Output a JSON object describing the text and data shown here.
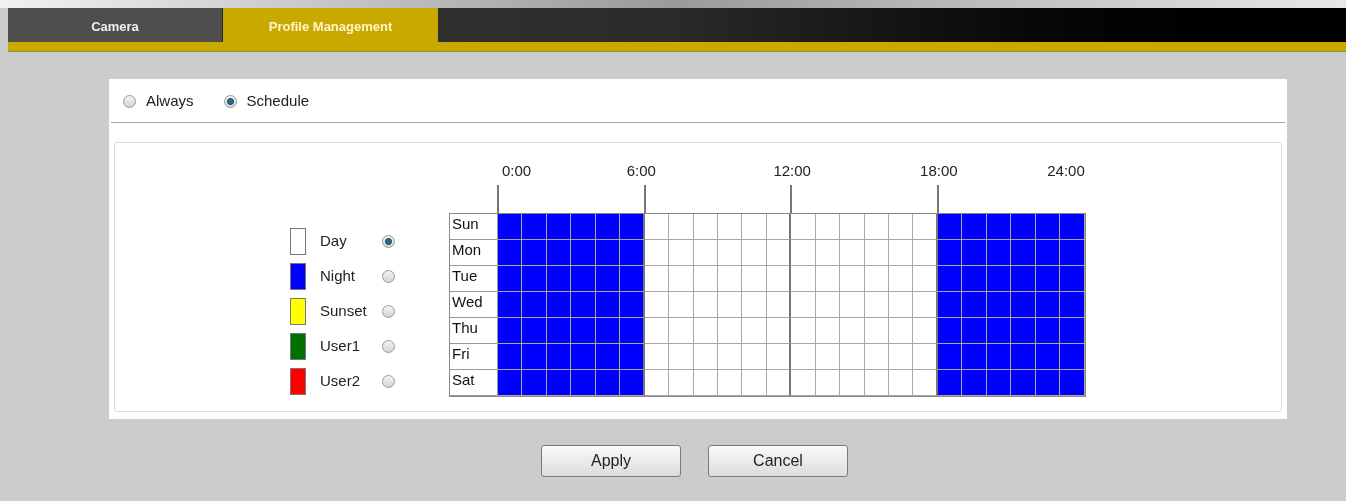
{
  "tabs": [
    {
      "label": "Camera",
      "selected": false
    },
    {
      "label": "Profile Management",
      "selected": true
    }
  ],
  "mode_options": [
    {
      "label": "Always",
      "selected": false
    },
    {
      "label": "Schedule",
      "selected": true
    }
  ],
  "profiles": [
    {
      "label": "Day",
      "color": "#ffffff",
      "selected": true
    },
    {
      "label": "Night",
      "color": "#0000ff",
      "selected": false
    },
    {
      "label": "Sunset",
      "color": "#ffff00",
      "selected": false
    },
    {
      "label": "User1",
      "color": "#007000",
      "selected": false
    },
    {
      "label": "User2",
      "color": "#ff0000",
      "selected": false
    }
  ],
  "time_labels": [
    "0:00",
    "6:00",
    "12:00",
    "18:00",
    "24:00"
  ],
  "schedule": [
    {
      "day": "Sun",
      "cells": [
        {
          "color": "#0000ff"
        },
        {
          "color": "#0000ff"
        },
        {
          "color": "#0000ff"
        },
        {
          "color": "#0000ff"
        },
        {
          "color": "#0000ff"
        },
        {
          "color": "#0000ff"
        },
        {
          "color": "#ffffff"
        },
        {
          "color": "#ffffff"
        },
        {
          "color": "#ffffff"
        },
        {
          "color": "#ffffff"
        },
        {
          "color": "#ffffff"
        },
        {
          "color": "#ffffff"
        },
        {
          "color": "#ffffff"
        },
        {
          "color": "#ffffff"
        },
        {
          "color": "#ffffff"
        },
        {
          "color": "#ffffff"
        },
        {
          "color": "#ffffff"
        },
        {
          "color": "#ffffff"
        },
        {
          "color": "#0000ff"
        },
        {
          "color": "#0000ff"
        },
        {
          "color": "#0000ff"
        },
        {
          "color": "#0000ff"
        },
        {
          "color": "#0000ff"
        },
        {
          "color": "#0000ff"
        }
      ]
    },
    {
      "day": "Mon",
      "cells": [
        {
          "color": "#0000ff"
        },
        {
          "color": "#0000ff"
        },
        {
          "color": "#0000ff"
        },
        {
          "color": "#0000ff"
        },
        {
          "color": "#0000ff"
        },
        {
          "color": "#0000ff"
        },
        {
          "color": "#ffffff"
        },
        {
          "color": "#ffffff"
        },
        {
          "color": "#ffffff"
        },
        {
          "color": "#ffffff"
        },
        {
          "color": "#ffffff"
        },
        {
          "color": "#ffffff"
        },
        {
          "color": "#ffffff"
        },
        {
          "color": "#ffffff"
        },
        {
          "color": "#ffffff"
        },
        {
          "color": "#ffffff"
        },
        {
          "color": "#ffffff"
        },
        {
          "color": "#ffffff"
        },
        {
          "color": "#0000ff"
        },
        {
          "color": "#0000ff"
        },
        {
          "color": "#0000ff"
        },
        {
          "color": "#0000ff"
        },
        {
          "color": "#0000ff"
        },
        {
          "color": "#0000ff"
        }
      ]
    },
    {
      "day": "Tue",
      "cells": [
        {
          "color": "#0000ff"
        },
        {
          "color": "#0000ff"
        },
        {
          "color": "#0000ff"
        },
        {
          "color": "#0000ff"
        },
        {
          "color": "#0000ff"
        },
        {
          "color": "#0000ff"
        },
        {
          "color": "#ffffff"
        },
        {
          "color": "#ffffff"
        },
        {
          "color": "#ffffff"
        },
        {
          "color": "#ffffff"
        },
        {
          "color": "#ffffff"
        },
        {
          "color": "#ffffff"
        },
        {
          "color": "#ffffff"
        },
        {
          "color": "#ffffff"
        },
        {
          "color": "#ffffff"
        },
        {
          "color": "#ffffff"
        },
        {
          "color": "#ffffff"
        },
        {
          "color": "#ffffff"
        },
        {
          "color": "#0000ff"
        },
        {
          "color": "#0000ff"
        },
        {
          "color": "#0000ff"
        },
        {
          "color": "#0000ff"
        },
        {
          "color": "#0000ff"
        },
        {
          "color": "#0000ff"
        }
      ]
    },
    {
      "day": "Wed",
      "cells": [
        {
          "color": "#0000ff"
        },
        {
          "color": "#0000ff"
        },
        {
          "color": "#0000ff"
        },
        {
          "color": "#0000ff"
        },
        {
          "color": "#0000ff"
        },
        {
          "color": "#0000ff"
        },
        {
          "color": "#ffffff"
        },
        {
          "color": "#ffffff"
        },
        {
          "color": "#ffffff"
        },
        {
          "color": "#ffffff"
        },
        {
          "color": "#ffffff"
        },
        {
          "color": "#ffffff"
        },
        {
          "color": "#ffffff"
        },
        {
          "color": "#ffffff"
        },
        {
          "color": "#ffffff"
        },
        {
          "color": "#ffffff"
        },
        {
          "color": "#ffffff"
        },
        {
          "color": "#ffffff"
        },
        {
          "color": "#0000ff"
        },
        {
          "color": "#0000ff"
        },
        {
          "color": "#0000ff"
        },
        {
          "color": "#0000ff"
        },
        {
          "color": "#0000ff"
        },
        {
          "color": "#0000ff"
        }
      ]
    },
    {
      "day": "Thu",
      "cells": [
        {
          "color": "#0000ff"
        },
        {
          "color": "#0000ff"
        },
        {
          "color": "#0000ff"
        },
        {
          "color": "#0000ff"
        },
        {
          "color": "#0000ff"
        },
        {
          "color": "#0000ff"
        },
        {
          "color": "#ffffff"
        },
        {
          "color": "#ffffff"
        },
        {
          "color": "#ffffff"
        },
        {
          "color": "#ffffff"
        },
        {
          "color": "#ffffff"
        },
        {
          "color": "#ffffff"
        },
        {
          "color": "#ffffff"
        },
        {
          "color": "#ffffff"
        },
        {
          "color": "#ffffff"
        },
        {
          "color": "#ffffff"
        },
        {
          "color": "#ffffff"
        },
        {
          "color": "#ffffff"
        },
        {
          "color": "#0000ff"
        },
        {
          "color": "#0000ff"
        },
        {
          "color": "#0000ff"
        },
        {
          "color": "#0000ff"
        },
        {
          "color": "#0000ff"
        },
        {
          "color": "#0000ff"
        }
      ]
    },
    {
      "day": "Fri",
      "cells": [
        {
          "color": "#0000ff"
        },
        {
          "color": "#0000ff"
        },
        {
          "color": "#0000ff"
        },
        {
          "color": "#0000ff"
        },
        {
          "color": "#0000ff"
        },
        {
          "color": "#0000ff"
        },
        {
          "color": "#ffffff"
        },
        {
          "color": "#ffffff"
        },
        {
          "color": "#ffffff"
        },
        {
          "color": "#ffffff"
        },
        {
          "color": "#ffffff"
        },
        {
          "color": "#ffffff"
        },
        {
          "color": "#ffffff"
        },
        {
          "color": "#ffffff"
        },
        {
          "color": "#ffffff"
        },
        {
          "color": "#ffffff"
        },
        {
          "color": "#ffffff"
        },
        {
          "color": "#ffffff"
        },
        {
          "color": "#0000ff"
        },
        {
          "color": "#0000ff"
        },
        {
          "color": "#0000ff"
        },
        {
          "color": "#0000ff"
        },
        {
          "color": "#0000ff"
        },
        {
          "color": "#0000ff"
        }
      ]
    },
    {
      "day": "Sat",
      "cells": [
        {
          "color": "#0000ff"
        },
        {
          "color": "#0000ff"
        },
        {
          "color": "#0000ff"
        },
        {
          "color": "#0000ff"
        },
        {
          "color": "#0000ff"
        },
        {
          "color": "#0000ff"
        },
        {
          "color": "#ffffff"
        },
        {
          "color": "#ffffff"
        },
        {
          "color": "#ffffff"
        },
        {
          "color": "#ffffff"
        },
        {
          "color": "#ffffff"
        },
        {
          "color": "#ffffff"
        },
        {
          "color": "#ffffff"
        },
        {
          "color": "#ffffff"
        },
        {
          "color": "#ffffff"
        },
        {
          "color": "#ffffff"
        },
        {
          "color": "#ffffff"
        },
        {
          "color": "#ffffff"
        },
        {
          "color": "#0000ff"
        },
        {
          "color": "#0000ff"
        },
        {
          "color": "#0000ff"
        },
        {
          "color": "#0000ff"
        },
        {
          "color": "#0000ff"
        },
        {
          "color": "#0000ff"
        }
      ]
    }
  ],
  "buttons": [
    "Apply",
    "Cancel"
  ]
}
